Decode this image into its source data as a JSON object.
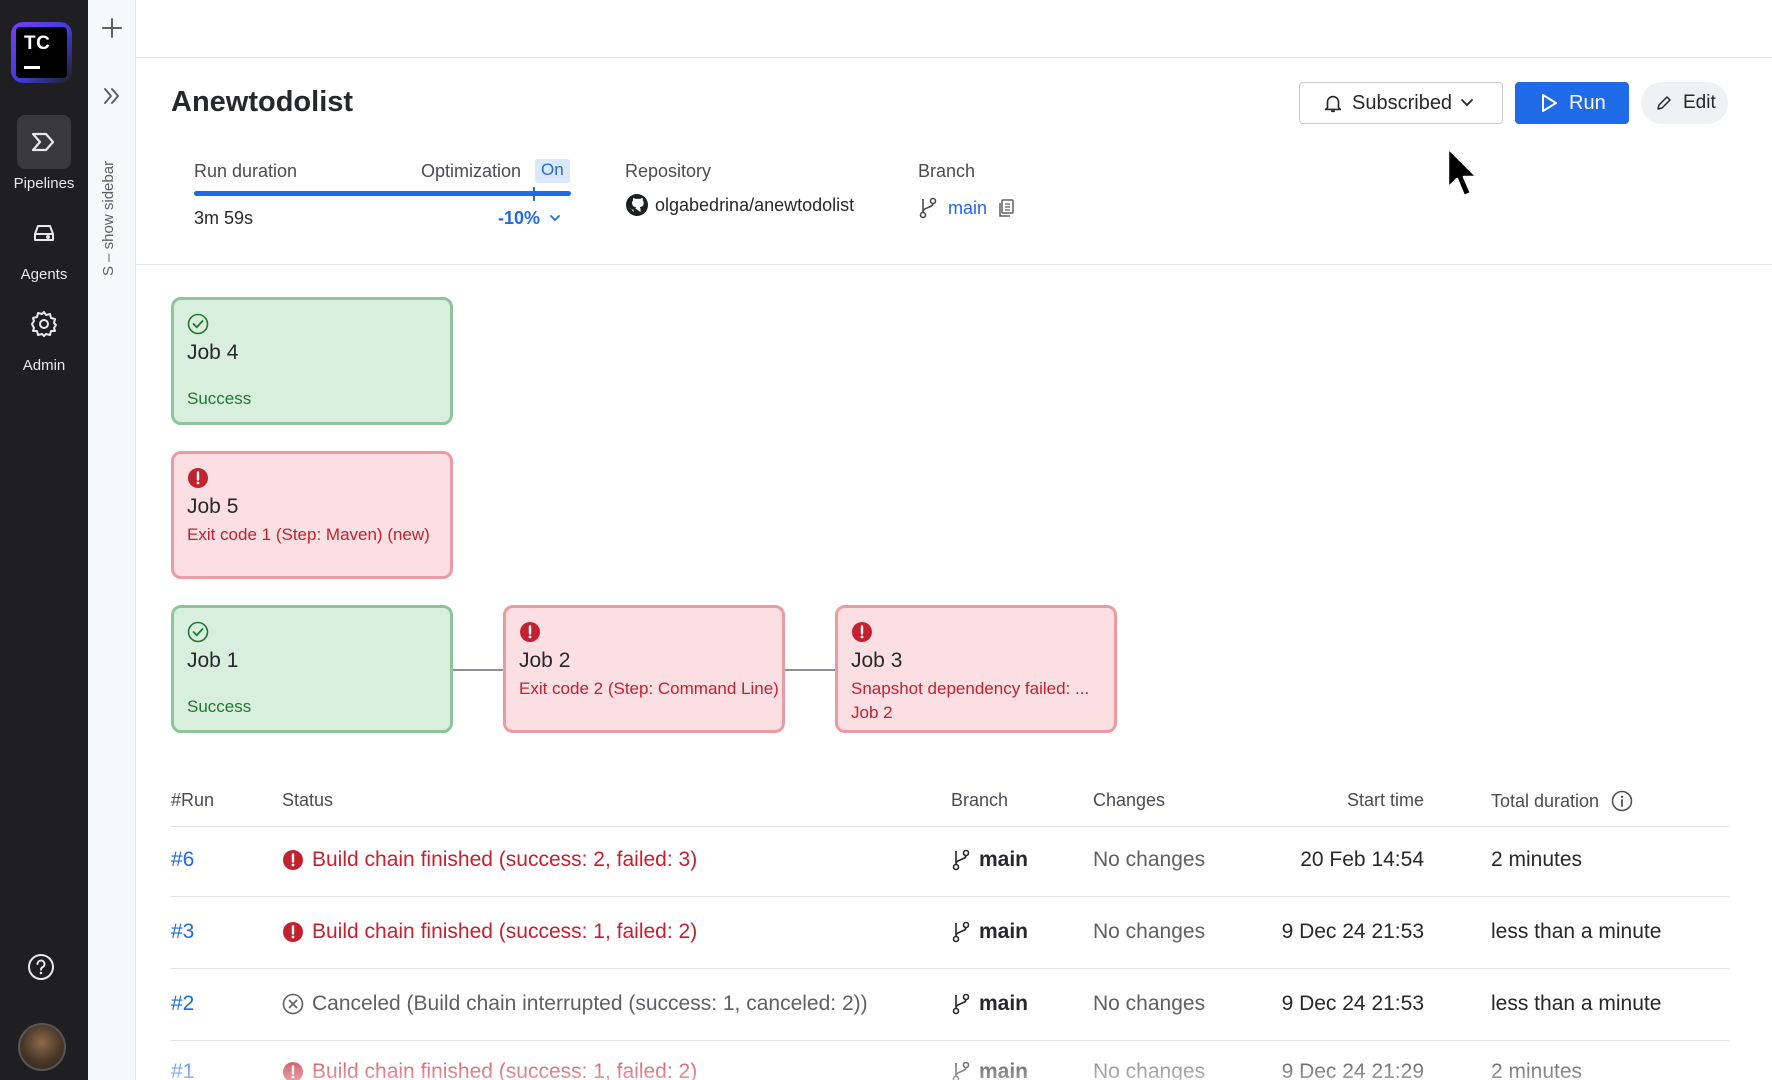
{
  "nav": {
    "logo_text": "TC",
    "items": [
      {
        "label": "Pipelines",
        "icon": "pipelines-icon",
        "active": true
      },
      {
        "label": "Agents",
        "icon": "agents-icon",
        "active": false
      },
      {
        "label": "Admin",
        "icon": "gear-icon",
        "active": false
      }
    ]
  },
  "sidebar": {
    "toggle_hint": "S – show sidebar"
  },
  "header": {
    "title": "Anewtodolist",
    "subscribed_label": "Subscribed",
    "run_label": "Run",
    "edit_label": "Edit"
  },
  "meta": {
    "run_duration_label": "Run duration",
    "run_duration_value": "3m 59s",
    "optimization_label": "Optimization",
    "optimization_state": "On",
    "optimization_delta": "-10%",
    "duration_progress_fraction": 1.0,
    "optimized_marker_fraction": 0.9,
    "repository_label": "Repository",
    "repository_value": "olgabedrina/anewtodolist",
    "branch_label": "Branch",
    "branch_value": "main"
  },
  "jobs": [
    {
      "name": "Job 4",
      "status": "success",
      "message": "Success"
    },
    {
      "name": "Job 5",
      "status": "failed",
      "message": "Exit code 1 (Step: Maven) (new)"
    },
    {
      "name": "Job 1",
      "status": "success",
      "message": "Success"
    },
    {
      "name": "Job 2",
      "status": "failed",
      "message": "Exit code 2 (Step: Command Line)"
    },
    {
      "name": "Job 3",
      "status": "failed",
      "message": "Snapshot dependency failed: ... Job 2"
    }
  ],
  "table": {
    "headers": {
      "run": "#Run",
      "status": "Status",
      "branch": "Branch",
      "changes": "Changes",
      "start_time": "Start time",
      "total_duration": "Total duration"
    },
    "rows": [
      {
        "run": "#6",
        "status_type": "failed",
        "status": "Build chain finished (success: 2, failed: 3)",
        "branch": "main",
        "changes": "No changes",
        "start_time": "20 Feb 14:54",
        "duration": "2 minutes"
      },
      {
        "run": "#3",
        "status_type": "failed",
        "status": "Build chain finished (success: 1, failed: 2)",
        "branch": "main",
        "changes": "No changes",
        "start_time": "9 Dec 24 21:53",
        "duration": "less than a minute"
      },
      {
        "run": "#2",
        "status_type": "canceled",
        "status": "Canceled (Build chain interrupted (success: 1, canceled: 2))",
        "branch": "main",
        "changes": "No changes",
        "start_time": "9 Dec 24 21:53",
        "duration": "less than a minute"
      },
      {
        "run": "#1",
        "status_type": "failed",
        "status": "Build chain finished (success: 1, failed: 2)",
        "branch": "main",
        "changes": "No changes",
        "start_time": "9 Dec 24 21:29",
        "duration": "2 minutes"
      }
    ]
  },
  "colors": {
    "accent": "#1f6ae6",
    "success_bg": "#d9efdd",
    "success_border": "#8cc69a",
    "success_text": "#20772f",
    "fail_bg": "#fbdfe3",
    "fail_border": "#ec9aa4",
    "fail_text": "#c4212f",
    "nav_bg": "#1f1f22"
  }
}
